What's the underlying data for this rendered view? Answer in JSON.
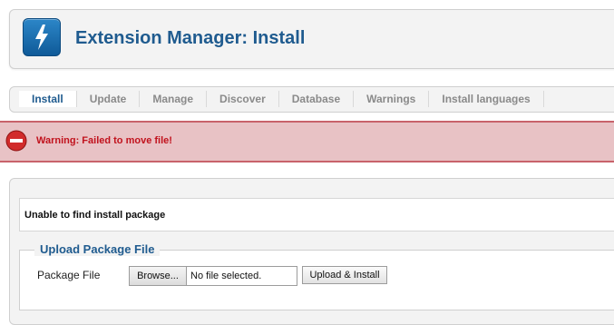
{
  "header": {
    "title": "Extension Manager: Install",
    "icon": "extension-lightning-icon"
  },
  "tabs": [
    {
      "label": "Install",
      "active": true
    },
    {
      "label": "Update",
      "active": false
    },
    {
      "label": "Manage",
      "active": false
    },
    {
      "label": "Discover",
      "active": false
    },
    {
      "label": "Database",
      "active": false
    },
    {
      "label": "Warnings",
      "active": false
    },
    {
      "label": "Install languages",
      "active": false
    }
  ],
  "warning": {
    "text": "Warning: Failed to move file!",
    "icon": "stop-icon",
    "color": "#c1121d"
  },
  "main": {
    "message": "Unable to find install package",
    "upload": {
      "legend": "Upload Package File",
      "field_label": "Package File",
      "browse_label": "Browse...",
      "file_status": "No file selected.",
      "submit_label": "Upload & Install"
    }
  },
  "colors": {
    "accent": "#1f5b8f",
    "warning_bg": "#e8c2c5",
    "warning_border": "#c8636b"
  }
}
